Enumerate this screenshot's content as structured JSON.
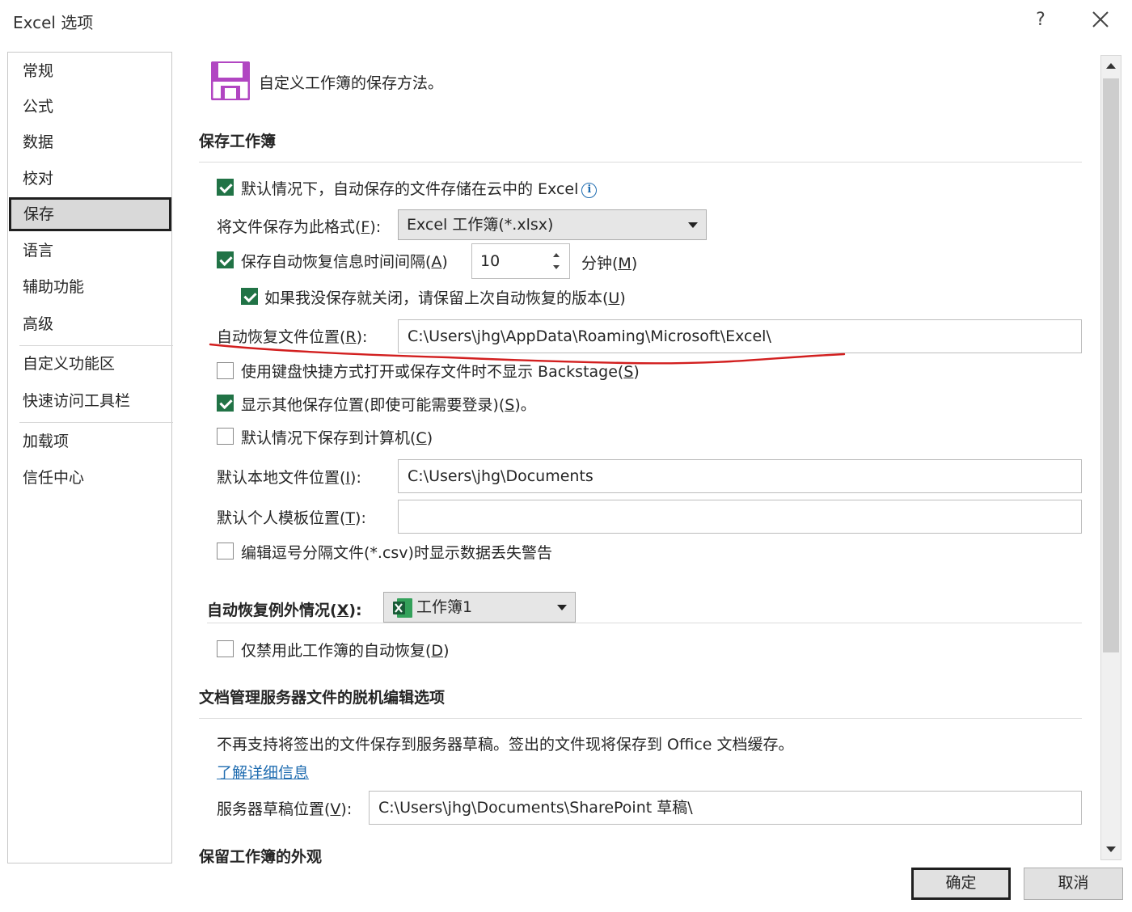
{
  "window": {
    "title": "Excel 选项",
    "help_label": "?"
  },
  "sidebar": {
    "items": [
      {
        "label": "常规"
      },
      {
        "label": "公式"
      },
      {
        "label": "数据"
      },
      {
        "label": "校对"
      },
      {
        "label": "保存",
        "selected": true
      },
      {
        "label": "语言"
      },
      {
        "label": "辅助功能"
      },
      {
        "label": "高级"
      },
      {
        "label": "自定义功能区"
      },
      {
        "label": "快速访问工具栏"
      },
      {
        "label": "加载项"
      },
      {
        "label": "信任中心"
      }
    ]
  },
  "header": {
    "text": "自定义工作簿的保存方法。",
    "icon": "save-icon",
    "icon_color": "#b146c2"
  },
  "save_workbooks": {
    "title": "保存工作簿",
    "autosave_cloud": {
      "label": "默认情况下，自动保存的文件存储在云中的 Excel",
      "checked": true
    },
    "format": {
      "label_pre": "将文件保存为此格式(",
      "key": "F",
      "label_post": "):",
      "value": "Excel 工作簿(*.xlsx)"
    },
    "autorecover_interval": {
      "label_pre": "保存自动恢复信息时间间隔(",
      "key": "A",
      "label_post": ")",
      "checked": true,
      "value": "10",
      "unit_pre": "分钟(",
      "unit_key": "M",
      "unit_post": ")"
    },
    "keep_last_version": {
      "label_pre": "如果我没保存就关闭，请保留上次自动恢复的版本(",
      "key": "U",
      "label_post": ")",
      "checked": true
    },
    "autorecover_location": {
      "label_pre": "自动恢复文件位置(",
      "key": "R",
      "label_post": "):",
      "value": "C:\\Users\\jhg\\AppData\\Roaming\\Microsoft\\Excel\\"
    },
    "no_backstage": {
      "label_pre": "使用键盘快捷方式打开或保存文件时不显示 Backstage(",
      "key": "S",
      "label_post": ")",
      "checked": false
    },
    "show_other_locations": {
      "label_pre": "显示其他保存位置(即使可能需要登录)(",
      "key": "S",
      "label_post": ")。",
      "checked": true
    },
    "save_to_computer": {
      "label_pre": "默认情况下保存到计算机(",
      "key": "C",
      "label_post": ")",
      "checked": false
    },
    "default_local_location": {
      "label_pre": "默认本地文件位置(",
      "key": "I",
      "label_post": "):",
      "value": "C:\\Users\\jhg\\Documents"
    },
    "default_template_location": {
      "label_pre": "默认个人模板位置(",
      "key": "T",
      "label_post": "):",
      "value": ""
    },
    "csv_warning": {
      "label": "编辑逗号分隔文件(*.csv)时显示数据丢失警告",
      "checked": false
    }
  },
  "autorecover_exceptions": {
    "label_pre": "自动恢复例外情况(",
    "key": "X",
    "label_post": "):",
    "workbook": "工作簿1",
    "disable": {
      "label_pre": "仅禁用此工作簿的自动恢复(",
      "key": "D",
      "label_post": ")",
      "checked": false
    }
  },
  "offline_editing": {
    "title": "文档管理服务器文件的脱机编辑选项",
    "description": "不再支持将签出的文件保存到服务器草稿。签出的文件现将保存到 Office 文档缓存。",
    "learn_more": "了解详细信息",
    "drafts_location": {
      "label_pre": "服务器草稿位置(",
      "key": "V",
      "label_post": "):",
      "value": "C:\\Users\\jhg\\Documents\\SharePoint 草稿\\"
    }
  },
  "preserve_appearance": {
    "title": "保留工作簿的外观"
  },
  "footer": {
    "ok": "确定",
    "cancel": "取消"
  },
  "colors": {
    "checkbox": "#217346",
    "link": "#1f6cb0",
    "annotation": "#d21f1f",
    "excel_green": "#217346"
  }
}
